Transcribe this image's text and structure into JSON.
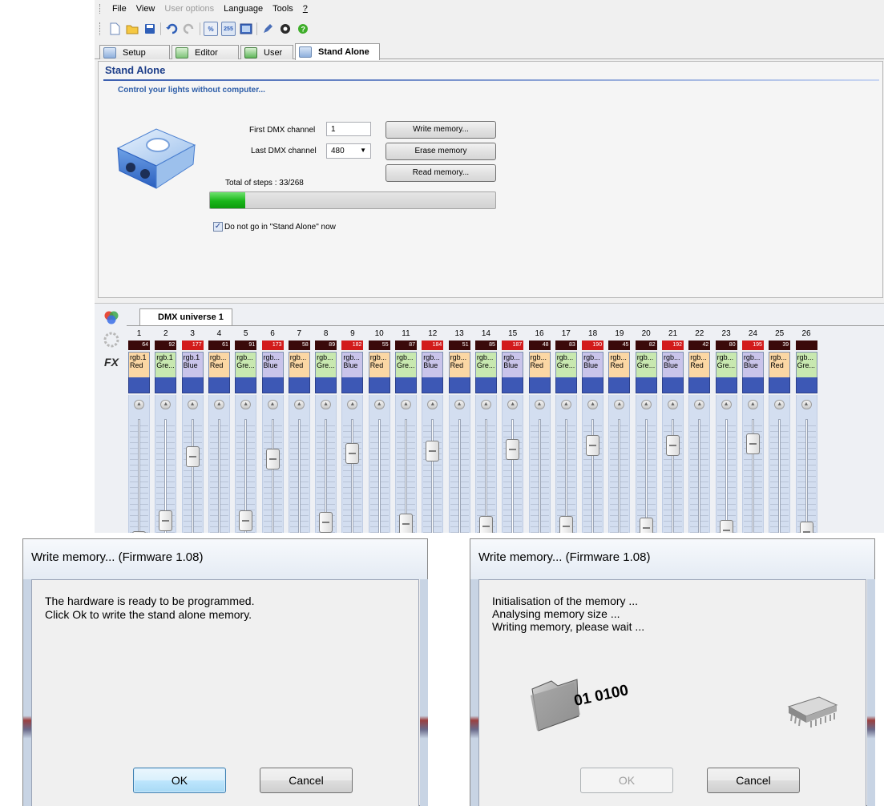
{
  "menu": {
    "items": [
      {
        "label": "File",
        "disabled": false
      },
      {
        "label": "View",
        "disabled": false
      },
      {
        "label": "User options",
        "disabled": true
      },
      {
        "label": "Language",
        "disabled": false
      },
      {
        "label": "Tools",
        "disabled": false
      },
      {
        "label": "?",
        "disabled": false
      }
    ]
  },
  "toolbar": {
    "icons": [
      "new-file-icon",
      "open-folder-icon",
      "save-icon",
      "undo-icon",
      "redo-icon",
      "scene-icon",
      "dmx-512-icon",
      "monitor-icon",
      "pen-icon",
      "info-icon",
      "help-icon"
    ]
  },
  "tabs": [
    {
      "label": "Setup",
      "active": false
    },
    {
      "label": "Editor",
      "active": false
    },
    {
      "label": "User",
      "active": false
    },
    {
      "label": "Stand Alone",
      "active": true
    }
  ],
  "stand_alone": {
    "title": "Stand Alone",
    "subtitle": "Control your lights without computer...",
    "first_dmx_label": "First DMX channel",
    "first_dmx_value": "1",
    "last_dmx_label": "Last DMX channel",
    "last_dmx_value": "480",
    "write_button": "Write memory...",
    "erase_button": "Erase memory",
    "read_button": "Read memory...",
    "total_steps_label": "Total of steps : 33/268",
    "progress": 0.123,
    "checkbox_label": "Do not go in \"Stand Alone\" now",
    "checkbox_checked": true
  },
  "dmx": {
    "tab_label": "DMX universe 1",
    "channels": [
      {
        "num": "1",
        "value": "64",
        "name1": "rgb.1",
        "name2": "Red",
        "fader": 0.25
      },
      {
        "num": "2",
        "value": "92",
        "name1": "rgb.1",
        "name2": "Gre...",
        "fader": 0.36
      },
      {
        "num": "3",
        "value": "177",
        "name1": "rgb.1",
        "name2": "Blue",
        "fader": 0.69
      },
      {
        "num": "4",
        "value": "61",
        "name1": "rgb...",
        "name2": "Red",
        "fader": 0.24
      },
      {
        "num": "5",
        "value": "91",
        "name1": "rgb...",
        "name2": "Gre...",
        "fader": 0.36
      },
      {
        "num": "6",
        "value": "173",
        "name1": "rgb...",
        "name2": "Blue",
        "fader": 0.68
      },
      {
        "num": "7",
        "value": "58",
        "name1": "rgb...",
        "name2": "Red",
        "fader": 0.23
      },
      {
        "num": "8",
        "value": "89",
        "name1": "rgb...",
        "name2": "Gre...",
        "fader": 0.35
      },
      {
        "num": "9",
        "value": "182",
        "name1": "rgb...",
        "name2": "Blue",
        "fader": 0.71
      },
      {
        "num": "10",
        "value": "55",
        "name1": "rgb...",
        "name2": "Red",
        "fader": 0.22
      },
      {
        "num": "11",
        "value": "87",
        "name1": "rgb...",
        "name2": "Gre...",
        "fader": 0.34
      },
      {
        "num": "12",
        "value": "184",
        "name1": "rgb...",
        "name2": "Blue",
        "fader": 0.72
      },
      {
        "num": "13",
        "value": "51",
        "name1": "rgb...",
        "name2": "Red",
        "fader": 0.2
      },
      {
        "num": "14",
        "value": "85",
        "name1": "rgb...",
        "name2": "Gre...",
        "fader": 0.33
      },
      {
        "num": "15",
        "value": "187",
        "name1": "rgb...",
        "name2": "Blue",
        "fader": 0.73
      },
      {
        "num": "16",
        "value": "48",
        "name1": "rgb...",
        "name2": "Red",
        "fader": 0.19
      },
      {
        "num": "17",
        "value": "83",
        "name1": "rgb...",
        "name2": "Gre...",
        "fader": 0.33
      },
      {
        "num": "18",
        "value": "190",
        "name1": "rgb...",
        "name2": "Blue",
        "fader": 0.75
      },
      {
        "num": "19",
        "value": "45",
        "name1": "rgb...",
        "name2": "Red",
        "fader": 0.18
      },
      {
        "num": "20",
        "value": "82",
        "name1": "rgb...",
        "name2": "Gre...",
        "fader": 0.32
      },
      {
        "num": "21",
        "value": "192",
        "name1": "rgb...",
        "name2": "Blue",
        "fader": 0.75
      },
      {
        "num": "22",
        "value": "42",
        "name1": "rgb...",
        "name2": "Red",
        "fader": 0.16
      },
      {
        "num": "23",
        "value": "80",
        "name1": "rgb...",
        "name2": "Gre...",
        "fader": 0.31
      },
      {
        "num": "24",
        "value": "195",
        "name1": "rgb...",
        "name2": "Blue",
        "fader": 0.76
      },
      {
        "num": "25",
        "value": "39",
        "name1": "rgb...",
        "name2": "Red",
        "fader": 0.15
      },
      {
        "num": "26",
        "value": "",
        "name1": "rgb...",
        "name2": "Gre...",
        "fader": 0.3
      }
    ],
    "colors": {
      "red_label_bg": "#fbd7a4",
      "green_label_bg": "#c8e8b0",
      "blue_label_bg": "#c9c4ea",
      "value_dark": "#3a0a0a",
      "value_red": "#d21b1b",
      "fader_bar": "#3d58b5"
    }
  },
  "dialog_left": {
    "title": "Write memory...  (Firmware 1.08)",
    "line1": "The hardware is ready to be programmed.",
    "line2": "Click Ok to write the stand alone memory.",
    "ok_label": "OK",
    "cancel_label": "Cancel"
  },
  "dialog_right": {
    "title": "Write memory...  (Firmware 1.08)",
    "line1": "Initialisation of the memory ...",
    "line2": "Analysing memory size ...",
    "line3": "Writing memory, please wait ...",
    "bits": "01 0100",
    "ok_label": "OK",
    "cancel_label": "Cancel"
  }
}
